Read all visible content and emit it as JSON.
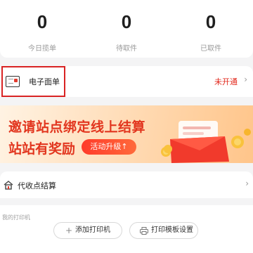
{
  "stats": [
    {
      "value": "0",
      "label": "今日揽单"
    },
    {
      "value": "0",
      "label": "待取件"
    },
    {
      "value": "0",
      "label": "已取件"
    }
  ],
  "waybill": {
    "label": "电子面单",
    "status": "未开通",
    "chevron": "›"
  },
  "banner": {
    "title_line1": "邀请站点绑定线上结算",
    "title_line2": "站站有奖励",
    "button": "活动升级↑"
  },
  "settlement": {
    "label": "代收点结算",
    "chevron": "›"
  },
  "printer": {
    "section_label": "我的打印机",
    "add_button_icon": "+",
    "add_button": "添加打印机",
    "template_button": "打印模板设置"
  },
  "colors": {
    "accent_red": "#e2281c",
    "banner_bg": "#ffd9b1",
    "highlight_border": "#d92323"
  },
  "icons": [
    "waybill-card-icon",
    "home-icon",
    "chevron-right-icon",
    "plus-icon",
    "printer-icon",
    "red-envelope-icon",
    "coin-icon"
  ]
}
